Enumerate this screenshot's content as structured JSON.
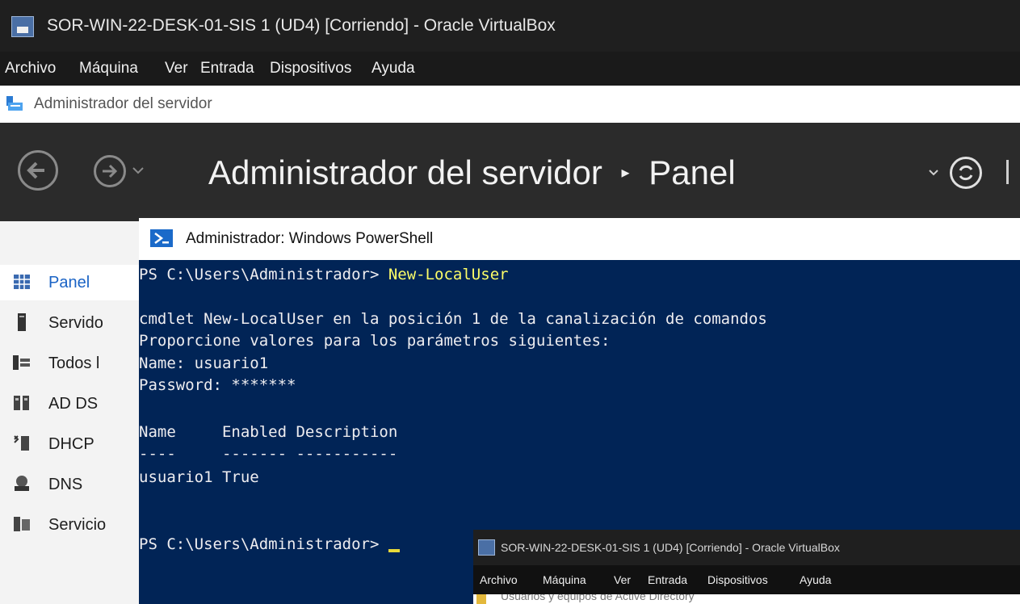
{
  "vbox": {
    "title": "SOR-WIN-22-DESK-01-SIS 1 (UD4) [Corriendo] - Oracle VirtualBox",
    "menu": [
      "Archivo",
      "Máquina",
      "Ver",
      "Entrada",
      "Dispositivos",
      "Ayuda"
    ]
  },
  "server_manager": {
    "window_title": "Administrador del servidor",
    "breadcrumb_root": "Administrador del servidor",
    "breadcrumb_sep": "▸",
    "breadcrumb_page": "Panel",
    "sidebar": [
      {
        "label": "Panel",
        "icon": "dashboard-icon",
        "active": true
      },
      {
        "label": "Servido",
        "icon": "server-icon"
      },
      {
        "label": "Todos l",
        "icon": "all-servers-icon"
      },
      {
        "label": "AD DS",
        "icon": "ad-ds-icon"
      },
      {
        "label": "DHCP",
        "icon": "dhcp-icon"
      },
      {
        "label": "DNS",
        "icon": "dns-icon"
      },
      {
        "label": "Servicio",
        "icon": "file-services-icon"
      }
    ]
  },
  "powershell": {
    "title": "Administrador: Windows PowerShell",
    "lines": {
      "prompt1": "PS C:\\Users\\Administrador> ",
      "cmd1": "New-LocalUser",
      "l2": "cmdlet New-LocalUser en la posición 1 de la canalización de comandos",
      "l3": "Proporcione valores para los parámetros siguientes:",
      "l4": "Name: usuario1",
      "l5": "Password: *******",
      "l6": "Name     Enabled Description",
      "l7": "----     ------- -----------",
      "l8": "usuario1 True",
      "prompt2": "PS C:\\Users\\Administrador> "
    }
  },
  "vbox2": {
    "title": "SOR-WIN-22-DESK-01-SIS 1 (UD4) [Corriendo] - Oracle VirtualBox",
    "menu": [
      "Archivo",
      "Máquina",
      "Ver",
      "Entrada",
      "Dispositivos",
      "Ayuda"
    ],
    "partial_window_title": "Usuarios y equipos de Active Directory"
  }
}
